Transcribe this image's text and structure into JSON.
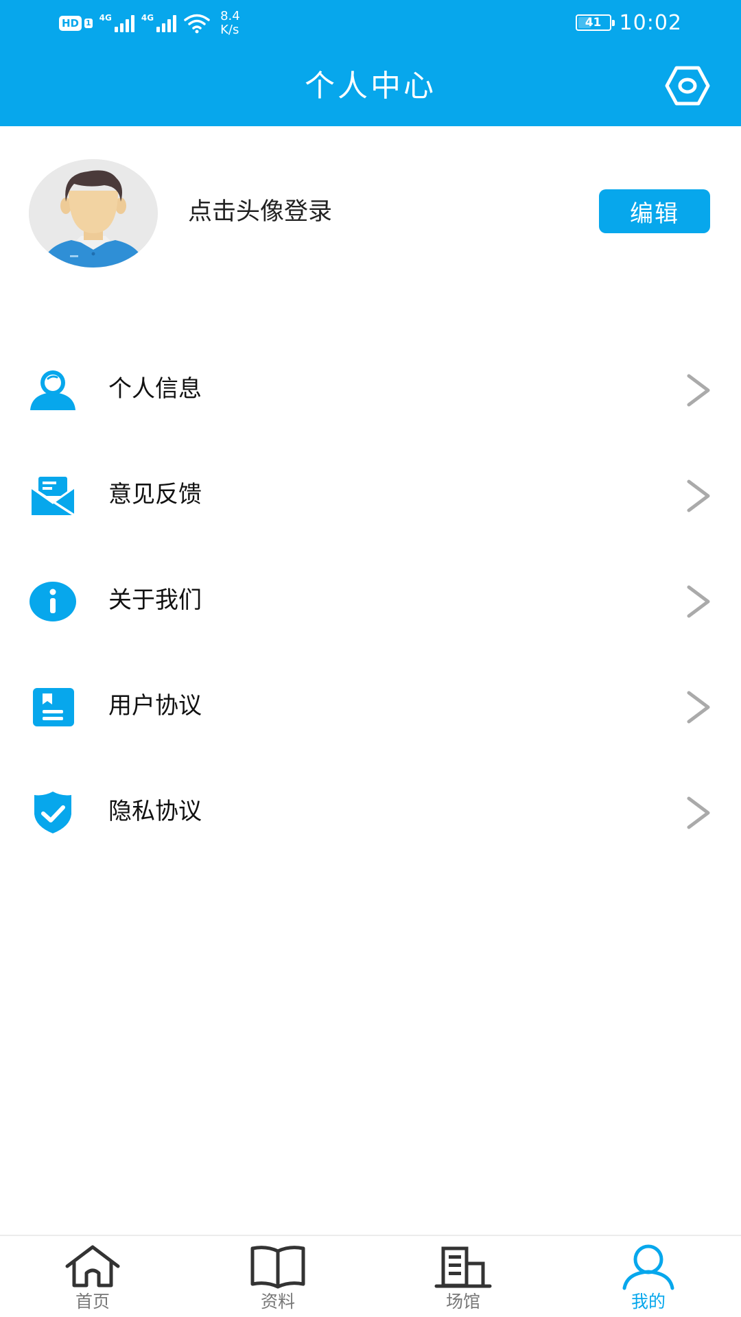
{
  "colors": {
    "primary": "#07a7ec",
    "chevron": "#aaaaaa",
    "text": "#111111",
    "nav_inactive": "#777777"
  },
  "status_bar": {
    "hd": "HD",
    "sim": "1",
    "network_1": "4G",
    "network_2": "4G",
    "net_speed_value": "8.4",
    "net_speed_unit": "K/s",
    "battery_level": "41",
    "battery_fraction": 0.41,
    "time": "10:02"
  },
  "header": {
    "title": "个人中心",
    "settings_icon": "hexagon-gear-icon"
  },
  "profile": {
    "avatar_icon": "default-user-avatar",
    "login_hint": "点击头像登录",
    "edit_label": "编辑"
  },
  "menu": {
    "items": [
      {
        "id": "personal-info",
        "label": "个人信息",
        "icon": "person-icon"
      },
      {
        "id": "feedback",
        "label": "意见反馈",
        "icon": "mail-icon"
      },
      {
        "id": "about-us",
        "label": "关于我们",
        "icon": "info-icon"
      },
      {
        "id": "user-agreement",
        "label": "用户协议",
        "icon": "document-icon"
      },
      {
        "id": "privacy-policy",
        "label": "隐私协议",
        "icon": "shield-check-icon"
      }
    ]
  },
  "bottom_nav": {
    "items": [
      {
        "id": "home",
        "label": "首页",
        "icon": "house-icon",
        "active": false
      },
      {
        "id": "materials",
        "label": "资料",
        "icon": "book-icon",
        "active": false
      },
      {
        "id": "venues",
        "label": "场馆",
        "icon": "building-icon",
        "active": false
      },
      {
        "id": "mine",
        "label": "我的",
        "icon": "person-outline-icon",
        "active": true
      }
    ]
  }
}
